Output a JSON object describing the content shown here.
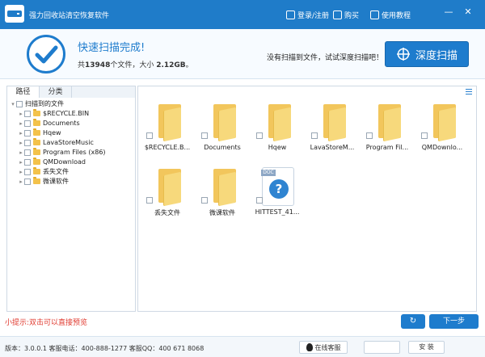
{
  "window": {
    "title": "强力回收站清空恢复软件",
    "links": [
      {
        "label": "登录/注册",
        "icon": "user-icon"
      },
      {
        "label": "购买",
        "icon": "cart-icon"
      },
      {
        "label": "使用教程",
        "icon": "book-icon"
      }
    ],
    "controls": [
      "—",
      "✕"
    ]
  },
  "header": {
    "status_icon": "check-circle-icon",
    "title": "快速扫描完成!",
    "summary_prefix": "共",
    "file_count": "13948",
    "summary_middle": "个文件，大小",
    "total_size": "2.12GB",
    "summary_suffix": "。",
    "deep_hint": "没有扫描到文件，试试深度扫描吧！",
    "deep_button": "深度扫描",
    "deep_icon": "crosshair-icon",
    "accent_color": "#1e7ccd"
  },
  "sidebar": {
    "tabs": [
      "路径",
      "分类"
    ],
    "root": "扫描到的文件",
    "items": [
      "$RECYCLE.BIN",
      "Documents",
      "Hqew",
      "LavaStoreMusic",
      "Program Files (x86)",
      "QMDownload",
      "丢失文件",
      "微课软件"
    ]
  },
  "files": {
    "folders": [
      "$RECYCLE.B...",
      "Documents",
      "Hqew",
      "LavaStoreM...",
      "Program Fil...",
      "QMDownlo...",
      "丢失文件",
      "微课软件"
    ],
    "doc_label": "HITTEST_41...",
    "doc_tag": "DOC"
  },
  "footer": {
    "tip": "小提示:双击可以直接预览",
    "back_button": "↻",
    "next_button": "下一步",
    "version_info": "版本：3.0.0.1  客服电话：400-888-1277    客服QQ：400 671 8068",
    "service_button": "在线客服",
    "btn_one": "",
    "btn_two": "安 装"
  }
}
